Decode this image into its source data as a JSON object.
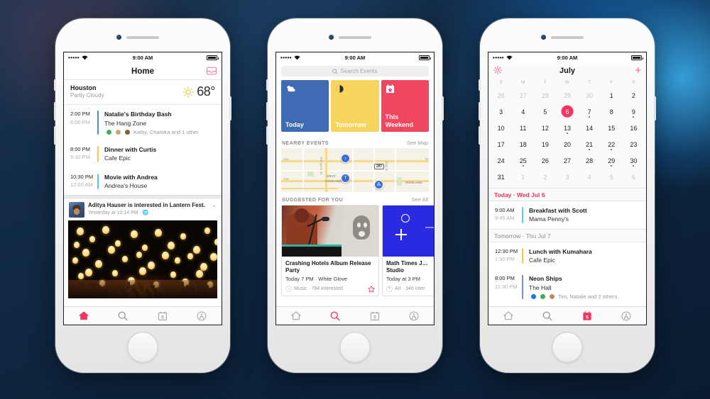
{
  "background": {
    "color_dark": "#0c2139",
    "color_accent": "#2f9fe0"
  },
  "theme": {
    "accent_pink": "#f2355e",
    "accent_light_pink": "#f4607c",
    "blue": "#3b6fd4",
    "yellow": "#f7d45e"
  },
  "phone1": {
    "status": {
      "signal": "•••••",
      "wifi": "wifi-icon",
      "time": "9:00 AM",
      "battery": "battery-full-icon"
    },
    "nav": {
      "title": "Home",
      "inbox_icon": "inbox-icon"
    },
    "weather": {
      "city": "Houston",
      "condition": "Partly Cloudy",
      "temp": "68°",
      "icon": "sun-icon"
    },
    "events": [
      {
        "start": "2:00 PM",
        "end": "6:00 PM",
        "title": "Natalie's Birthday Bash",
        "place": "The Hang Zone",
        "attendees": "Kathy, Chandra and 1 other",
        "bar_color": "#4a90d9",
        "has_avatars": true
      },
      {
        "start": "8:00 PM",
        "end": "9:30 PM",
        "title": "Dinner with Curtis",
        "place": "Cafe Epic",
        "attendees": "",
        "bar_color": "#f2c94c",
        "has_avatars": false
      },
      {
        "start": "10:30 PM",
        "end": "12:00 AM",
        "title": "Movie with Andrea",
        "place": "Andrea's House",
        "attendees": "",
        "bar_color": "#56ccf2",
        "has_avatars": false
      }
    ],
    "post": {
      "headline": "Aditya Hauser is interested in Lantern Fest.",
      "author": "Aditya Hauser",
      "timestamp": "Yesterday at 10:14 PM · ",
      "globe_icon": "globe-icon",
      "chevron": "chevron-down-icon",
      "photo_alt": "lantern-festival-photo"
    },
    "tabs": [
      {
        "icon": "home-icon",
        "active": true,
        "label": ""
      },
      {
        "icon": "search-icon",
        "active": false,
        "label": ""
      },
      {
        "icon": "calendar-icon",
        "active": false,
        "label": "6"
      },
      {
        "icon": "profile-icon",
        "active": false,
        "label": ""
      }
    ]
  },
  "phone2": {
    "status": {
      "signal": "•••••",
      "wifi": "wifi-icon",
      "time": "9:00 AM",
      "battery": "battery-full-icon"
    },
    "search": {
      "placeholder": "Search Events",
      "icon": "search-icon"
    },
    "categories": [
      {
        "label": "Today",
        "color": "#3f6bb5",
        "icon": "sun-cloud-icon"
      },
      {
        "label": "Tomorrow",
        "color": "#f7d45e",
        "icon": "moon-icon"
      },
      {
        "label": "This Weekend",
        "color": "#f2455f",
        "icon": "calendar-star-icon"
      }
    ],
    "nearby": {
      "header": "NEARBY EVENTS",
      "action": "See Map",
      "map_labels": [
        "Ave",
        "Ave",
        "Tennyson St",
        "Clay St",
        "WEST HIGHLAND",
        "HIGHLAND",
        "W"
      ],
      "highway_shield": "287",
      "pins": [
        "music-pin",
        "transit-pin",
        "people-pin"
      ]
    },
    "suggested": {
      "header": "SUGGESTED FOR YOU",
      "action": "See All",
      "cards": [
        {
          "title": "Crashing Hotels Album Release Party",
          "meta": "Today 7 PM · White Glove",
          "category": "Music",
          "interested": "784 interested",
          "cat_icon": "music-note-icon",
          "star_icon": "star-outline-icon",
          "image": "concert-photo"
        },
        {
          "title": "Math Times J… Studio",
          "meta": "Today at 3 PM ·",
          "category": "Art",
          "interested": "346 inter",
          "cat_icon": "paint-icon",
          "star_icon": "star-outline-icon",
          "image": "blue-art-poster"
        }
      ]
    },
    "tabs": [
      {
        "icon": "home-icon",
        "active": false,
        "label": ""
      },
      {
        "icon": "search-icon",
        "active": true,
        "label": ""
      },
      {
        "icon": "calendar-icon",
        "active": false,
        "label": "6"
      },
      {
        "icon": "profile-icon",
        "active": false,
        "label": ""
      }
    ]
  },
  "phone3": {
    "status": {
      "signal": "•••••",
      "wifi": "wifi-icon",
      "time": "9:00 AM",
      "battery": "battery-full-icon"
    },
    "nav": {
      "month": "July",
      "gear_icon": "gear-icon",
      "add_icon": "plus-icon"
    },
    "calendar": {
      "dow": [
        "S",
        "M",
        "T",
        "W",
        "T",
        "F",
        "S"
      ],
      "weeks": [
        [
          {
            "n": "26",
            "muted": true
          },
          {
            "n": "27",
            "muted": true
          },
          {
            "n": "28",
            "muted": true
          },
          {
            "n": "29",
            "muted": true
          },
          {
            "n": "30",
            "muted": true
          },
          {
            "n": "1"
          },
          {
            "n": "2"
          }
        ],
        [
          {
            "n": "3"
          },
          {
            "n": "4"
          },
          {
            "n": "5"
          },
          {
            "n": "6",
            "selected": true
          },
          {
            "n": "7",
            "dot": true
          },
          {
            "n": "8"
          },
          {
            "n": "9",
            "dot": true
          }
        ],
        [
          {
            "n": "10"
          },
          {
            "n": "11"
          },
          {
            "n": "12"
          },
          {
            "n": "13",
            "dot": true
          },
          {
            "n": "14"
          },
          {
            "n": "15"
          },
          {
            "n": "16"
          }
        ],
        [
          {
            "n": "17"
          },
          {
            "n": "18"
          },
          {
            "n": "19"
          },
          {
            "n": "20"
          },
          {
            "n": "21",
            "dot": true
          },
          {
            "n": "22",
            "dot": true
          },
          {
            "n": "23"
          }
        ],
        [
          {
            "n": "24"
          },
          {
            "n": "25",
            "dot": true
          },
          {
            "n": "26"
          },
          {
            "n": "27"
          },
          {
            "n": "28"
          },
          {
            "n": "29",
            "dot": true
          },
          {
            "n": "30",
            "dot": true
          }
        ],
        [
          {
            "n": "31"
          },
          {
            "n": "1",
            "muted": true
          },
          {
            "n": "2",
            "muted": true
          },
          {
            "n": "3",
            "muted": true
          },
          {
            "n": "4",
            "muted": true
          },
          {
            "n": "5",
            "muted": true
          },
          {
            "n": "6",
            "muted": true
          }
        ]
      ]
    },
    "agenda": [
      {
        "type": "header",
        "label": "Today · Wed Jul 6",
        "today": true
      },
      {
        "type": "event",
        "start": "9:00 AM",
        "end": "9:45 AM",
        "title": "Breakfast with Scott",
        "place": "Mama Penny's",
        "attendees": "",
        "bar_color": "#56ccf2",
        "has_avatars": false
      },
      {
        "type": "header",
        "label": "Tomorrow · Thu Jul 7",
        "today": false
      },
      {
        "type": "event",
        "start": "12:30 PM",
        "end": "1:30 PM",
        "title": "Lunch with Kumahara",
        "place": "Cafe Epic",
        "attendees": "",
        "bar_color": "#f2c94c",
        "has_avatars": false
      },
      {
        "type": "event",
        "start": "8:00 PM",
        "end": "11:30 PM",
        "title": "Neon Ships",
        "place": "The Hall",
        "attendees": "Tim, Natalie and 2 others",
        "bar_color": "#7b8cde",
        "has_avatars": true
      }
    ],
    "tabs": [
      {
        "icon": "home-icon",
        "active": false,
        "label": ""
      },
      {
        "icon": "search-icon",
        "active": false,
        "label": ""
      },
      {
        "icon": "calendar-icon",
        "active": true,
        "label": "6"
      },
      {
        "icon": "profile-icon",
        "active": false,
        "label": ""
      }
    ]
  }
}
